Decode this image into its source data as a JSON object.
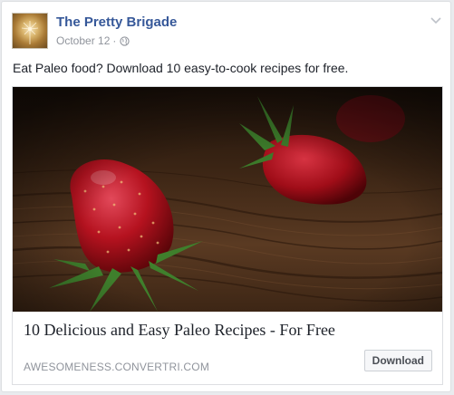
{
  "post": {
    "page_name": "The Pretty Brigade",
    "date": "October 12",
    "separator": "·",
    "privacy_icon": "globe-icon",
    "menu_icon": "chevron-down-icon",
    "status_text": "Eat Paleo food? Download 10 easy-to-cook recipes for free."
  },
  "link_card": {
    "image_subject": "strawberries-on-wooden-table",
    "title": "10 Delicious and Easy Paleo Recipes - For Free",
    "domain": "AWESOMENESS.CONVERTRI.COM",
    "cta_label": "Download"
  },
  "colors": {
    "name_link": "#365899",
    "meta_gray": "#90949c",
    "text": "#1d2129",
    "border": "#dddfe2"
  }
}
